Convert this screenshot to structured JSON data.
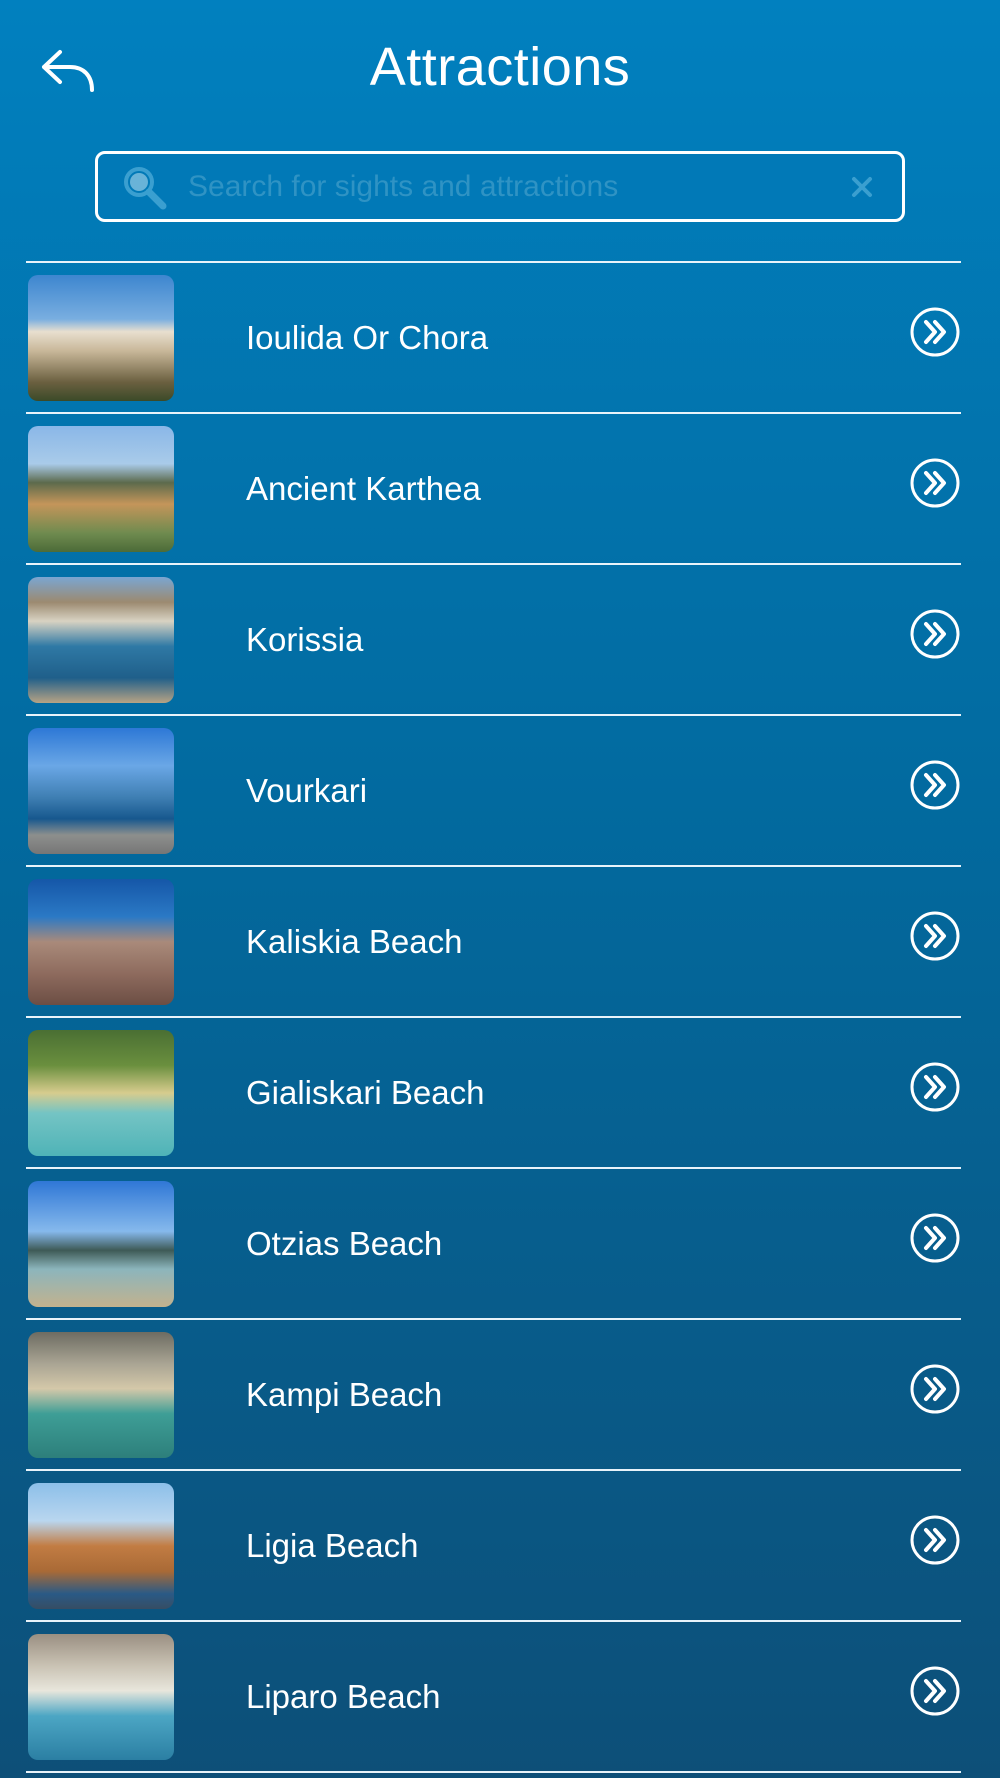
{
  "header": {
    "title": "Attractions",
    "back_icon": "undo-arrow-icon"
  },
  "search": {
    "placeholder": "Search for sights and attractions",
    "value": "",
    "search_icon": "magnifier-icon",
    "clear_icon": "close-icon"
  },
  "attractions": [
    {
      "label": "Ioulida Or Chora"
    },
    {
      "label": "Ancient Karthea"
    },
    {
      "label": "Korissia"
    },
    {
      "label": "Vourkari"
    },
    {
      "label": "Kaliskia Beach"
    },
    {
      "label": "Gialiskari Beach"
    },
    {
      "label": "Otzias Beach"
    },
    {
      "label": "Kampi Beach"
    },
    {
      "label": "Ligia Beach"
    },
    {
      "label": "Liparo Beach"
    }
  ],
  "colors": {
    "background_top": "#0180bf",
    "background_bottom": "#0d4f78",
    "divider": "#e8f3fa",
    "placeholder": "#2f93c4"
  }
}
